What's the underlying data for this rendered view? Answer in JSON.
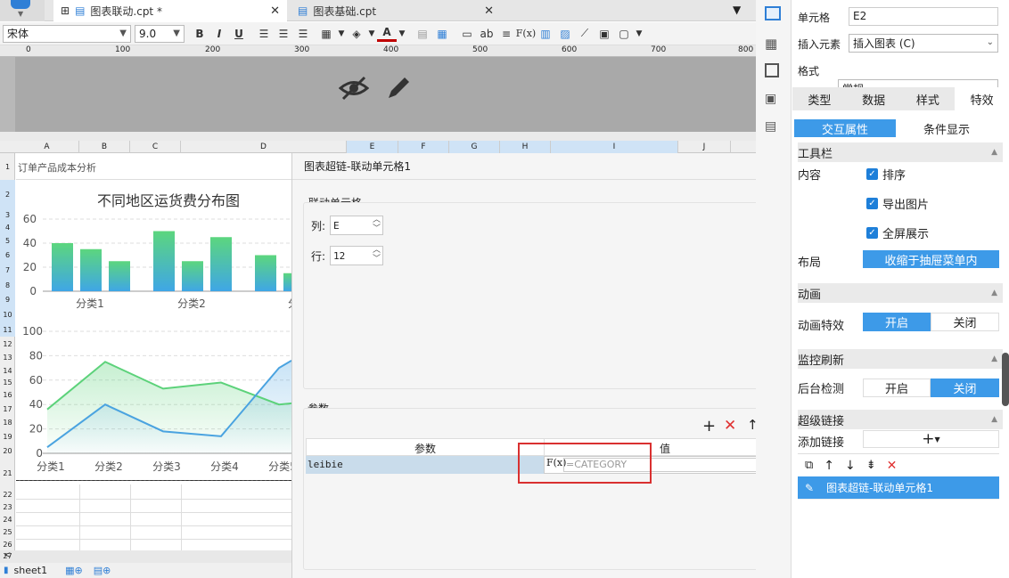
{
  "tabs": [
    {
      "label": "图表联动.cpt *"
    },
    {
      "label": "图表基础.cpt"
    }
  ],
  "toolbar": {
    "font": "宋体",
    "size": "9.0",
    "bold": "B",
    "italic": "I",
    "underline": "U",
    "fx": "F(x)",
    "ab": "ab",
    "text_color": "#c00000"
  },
  "ruler": {
    "ticks": [
      "0",
      "100",
      "200",
      "300",
      "400",
      "500",
      "600",
      "700",
      "800"
    ]
  },
  "columns": [
    "A",
    "B",
    "C",
    "D",
    "E",
    "F",
    "G",
    "H",
    "I",
    "J"
  ],
  "rows": [
    "1",
    "2",
    "3",
    "4",
    "5",
    "6",
    "7",
    "8",
    "9",
    "10",
    "11",
    "12",
    "13",
    "14",
    "15",
    "16",
    "17",
    "18",
    "19",
    "20",
    "21",
    "22",
    "23",
    "24",
    "25",
    "26",
    "27"
  ],
  "sheet": {
    "a1_text": "订单产品成本分析",
    "sheet_tab": "sheet1"
  },
  "chart_data": [
    {
      "type": "bar",
      "title": "不同地区运货费分布图",
      "categories": [
        "分类1",
        "分类2",
        "分"
      ],
      "ylim": [
        0,
        60
      ],
      "yticks": [
        "0",
        "20",
        "40",
        "60"
      ],
      "series": [
        {
          "values": [
            40,
            50,
            30
          ]
        },
        {
          "values": [
            35,
            25,
            15
          ]
        },
        {
          "values": [
            25,
            45,
            null
          ]
        }
      ]
    },
    {
      "type": "area",
      "categories": [
        "分类1",
        "分类2",
        "分类3",
        "分类4",
        "分类5"
      ],
      "ylim": [
        0,
        100
      ],
      "yticks": [
        "0",
        "20",
        "40",
        "60",
        "80",
        "100"
      ],
      "series": [
        {
          "values": [
            36,
            75,
            53,
            58,
            40
          ],
          "color": "#5cd27a"
        },
        {
          "values": [
            5,
            40,
            18,
            14,
            70
          ],
          "color": "#4aa3e0"
        }
      ]
    }
  ],
  "dialog": {
    "title": "图表超链-联动单元格1",
    "link_cell_label": "联动单元格",
    "col_label": "列:",
    "col_value": "E",
    "row_label": "行:",
    "row_value": "12",
    "params_label": "参数",
    "table_headers": [
      "参数",
      "值"
    ],
    "param_name": "leibie",
    "param_value": "=CATEGORY",
    "fx": "F(x)"
  },
  "right": {
    "cell_label": "单元格",
    "cell_value": "E2",
    "insert_label": "插入元素",
    "insert_value": "插入图表 (C)",
    "format_label": "格式",
    "format_value": "常规",
    "tabs": [
      "类型",
      "数据",
      "样式",
      "特效"
    ],
    "subtabs": [
      "交互属性",
      "条件显示"
    ],
    "toolbar_section": "工具栏",
    "content_label": "内容",
    "checks": [
      "排序",
      "导出图片",
      "全屏展示"
    ],
    "layout_label": "布局",
    "layout_value": "收缩于抽屉菜单内",
    "anim_section": "动画",
    "anim_label": "动画特效",
    "on": "开启",
    "off": "关闭",
    "monitor_section": "监控刷新",
    "bg_label": "后台检测",
    "hyper_section": "超级链接",
    "add_link_label": "添加链接",
    "link_item": "图表超链-联动单元格1"
  }
}
